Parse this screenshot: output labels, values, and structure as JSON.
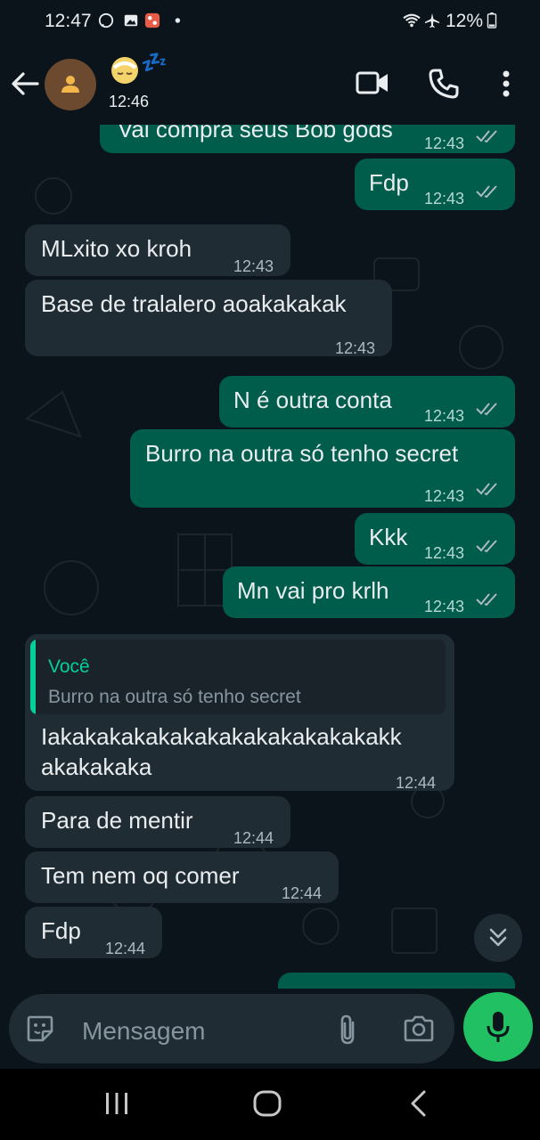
{
  "status_bar": {
    "time": "12:47",
    "battery_percent": "12%"
  },
  "header": {
    "contact_name": "💤",
    "subtitle": "12:46"
  },
  "messages": [
    {
      "text": "Vai compra seus Bob gods",
      "time": "12:43",
      "direction": "out"
    },
    {
      "text": "Fdp",
      "time": "12:43",
      "direction": "out"
    },
    {
      "text": "MLxito xo kroh",
      "time": "12:43",
      "direction": "in"
    },
    {
      "text": "Base de tralalero aoakakakak",
      "time": "12:43",
      "direction": "in"
    },
    {
      "text": "N é outra conta",
      "time": "12:43",
      "direction": "out"
    },
    {
      "text": "Burro na outra só tenho secret",
      "time": "12:43",
      "direction": "out"
    },
    {
      "text": "Kkk",
      "time": "12:43",
      "direction": "out"
    },
    {
      "text": "Mn vai pro krlh",
      "time": "12:43",
      "direction": "out"
    },
    {
      "reply_author": "Você",
      "reply_text": "Burro na outra só tenho secret",
      "text_line1": "Iakakakakakakakakakakakakakakk",
      "text_line2": "akakakaka",
      "time": "12:44",
      "direction": "in"
    },
    {
      "text": "Para de mentir",
      "time": "12:44",
      "direction": "in"
    },
    {
      "text": "Tem nem oq comer",
      "time": "12:44",
      "direction": "in"
    },
    {
      "text": "Fdp",
      "time": "12:44",
      "direction": "in"
    }
  ],
  "input": {
    "placeholder": "Mensagem"
  },
  "colors": {
    "background": "#0b141a",
    "incoming_bubble": "#202c33",
    "outgoing_bubble": "#005c4b",
    "accent_green": "#21c063"
  }
}
